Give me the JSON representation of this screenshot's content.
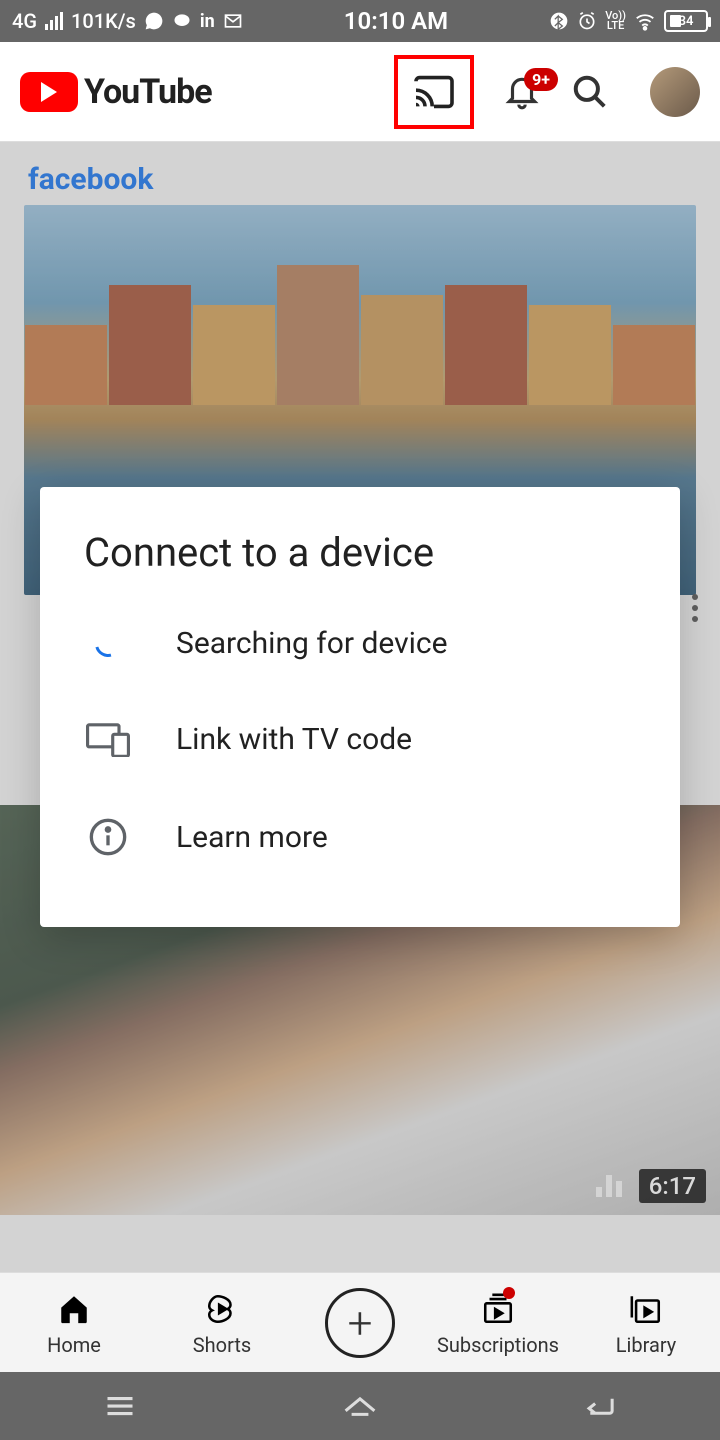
{
  "statusbar": {
    "network_type": "4G",
    "speed": "101K/s",
    "time": "10:10 AM",
    "volte": "Vo))\nLTE",
    "battery": "34"
  },
  "topbar": {
    "logo_text": "YouTube",
    "notification_badge": "9+"
  },
  "feed": {
    "sponsor_label": "facebook",
    "video2_duration": "6:17"
  },
  "modal": {
    "title": "Connect to a device",
    "searching": "Searching for device",
    "link_tv": "Link with TV code",
    "learn_more": "Learn more"
  },
  "bottomnav": {
    "home": "Home",
    "shorts": "Shorts",
    "subs": "Subscriptions",
    "library": "Library"
  }
}
